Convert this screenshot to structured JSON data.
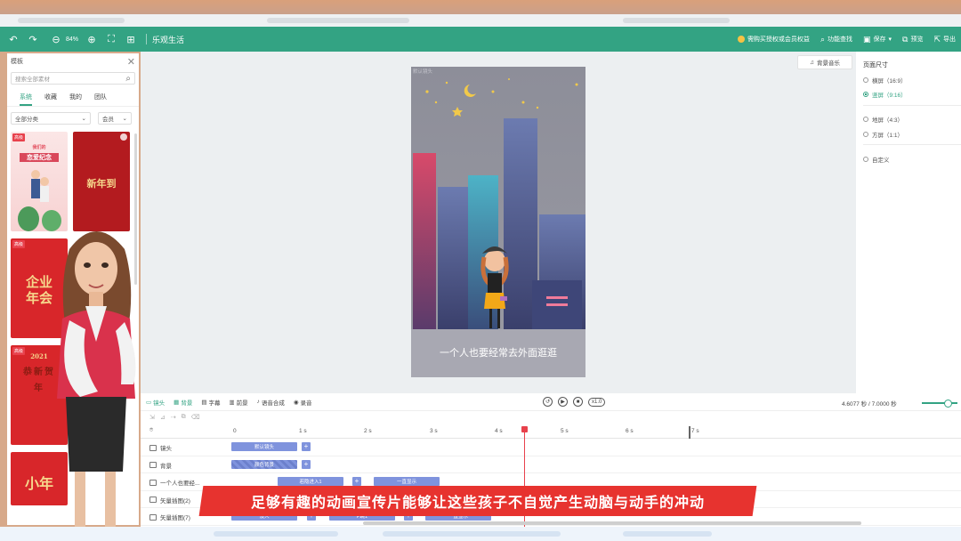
{
  "toolbar": {
    "zoom": "84%",
    "title": "乐观生活",
    "vip_label": "需购买授权或会员权益",
    "feature_search_label": "功能查找",
    "save_label": "保存",
    "preview_label": "预览",
    "export_label": "导出"
  },
  "left_panel": {
    "title": "模板",
    "search_placeholder": "搜索全部素材",
    "tabs": [
      "系统",
      "收藏",
      "我的",
      "团队"
    ],
    "active_tab": "系统",
    "filter_category": "全部分类",
    "filter_member": "会员",
    "thumbnails": [
      {
        "badge": "高级",
        "text_line1": "我们的",
        "text_line2": "恋爱纪念"
      },
      {
        "badge": "",
        "text_line1": "新年到",
        "text_line2": ""
      },
      {
        "badge": "高级",
        "text_line1": "企业",
        "text_line2": "年会"
      },
      {
        "badge": "高级",
        "text_line1": "2021",
        "text_line2": "恭新贺年"
      },
      {
        "badge": "",
        "text_line1": "小年",
        "text_line2": ""
      }
    ]
  },
  "canvas": {
    "background_music_label": "背景音乐",
    "stage_label": "默认镜头",
    "subtitle": "一个人也要经常去外面逛逛"
  },
  "right_panel": {
    "title": "页面尺寸",
    "options": [
      {
        "label": "横屏（16:9）",
        "selected": false
      },
      {
        "label": "竖屏（9:16）",
        "selected": true
      },
      {
        "label": "地屏（4:3）",
        "selected": false
      },
      {
        "label": "方屏（1:1）",
        "selected": false
      },
      {
        "label": "自定义",
        "selected": false
      }
    ]
  },
  "timeline": {
    "tabs": [
      "镜头",
      "背景",
      "字幕",
      "前景",
      "语音合成",
      "录音"
    ],
    "active_tabs": [
      "镜头",
      "背景"
    ],
    "speed": "x1.0",
    "time_display": "4.6077 秒 / 7.0000 秒",
    "ticks": [
      "0",
      "1 s",
      "2 s",
      "3 s",
      "4 s",
      "5 s",
      "6 s",
      "7 s"
    ],
    "rows": [
      {
        "label": "镜头",
        "clips": [
          "默认镜头"
        ]
      },
      {
        "label": "背景",
        "clips": [
          "颜色背景"
        ]
      },
      {
        "label": "一个人也要经...",
        "clips": [
          "若隐进入1",
          "一直显示"
        ]
      },
      {
        "label": "矢量插图(2)",
        "clips": []
      },
      {
        "label": "矢量插图(7)",
        "clips": [
          "淡入",
          "P跳1",
          "一直显示"
        ]
      }
    ]
  },
  "video_subtitle": "足够有趣的动画宣传片能够让这些孩子不自觉产生动脑与动手的冲动",
  "colors": {
    "brand": "#33a383",
    "clip": "#7f93dd",
    "playhead": "#e8414c",
    "subtitle_banner": "#e7332f"
  }
}
